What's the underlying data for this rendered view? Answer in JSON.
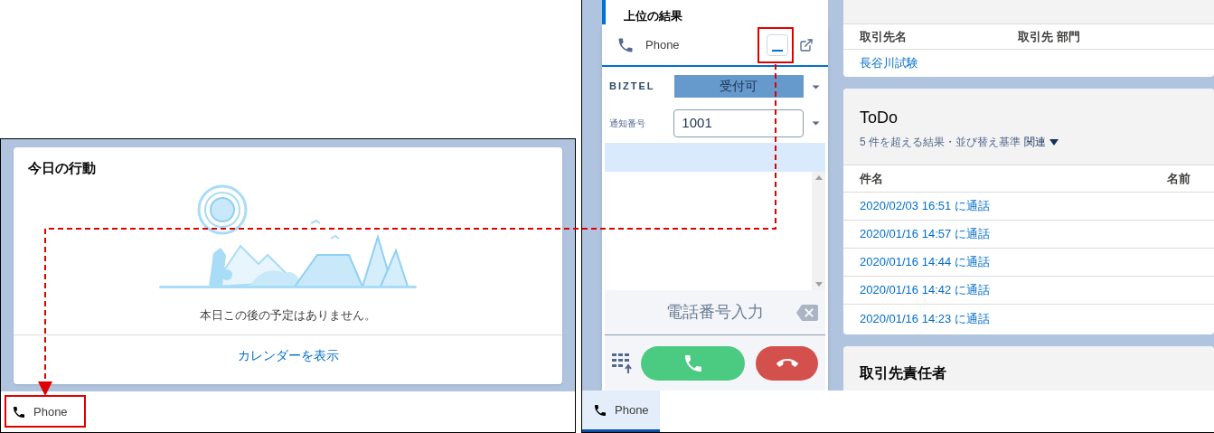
{
  "left_screen": {
    "card": {
      "title": "今日の行動",
      "message": "本日この後の予定はありません。",
      "link": "カレンダーを表示"
    },
    "utility_bar": {
      "items": [
        {
          "label": "Phone",
          "selected": false
        }
      ]
    }
  },
  "right_screen": {
    "results_panel": {
      "title": "上位の結果"
    },
    "phone_panel": {
      "title": "Phone",
      "brand": "BIZTEL",
      "status": "受付可",
      "caller_id_label": "通知番号",
      "caller_id": "1001",
      "dial_placeholder": "電話番号入力"
    },
    "accounts_card": {
      "columns": [
        "取引先名",
        "取引先 部門"
      ],
      "rows": [
        [
          "長谷川試験"
        ]
      ]
    },
    "todo_card": {
      "title": "ToDo",
      "subtitle": "5 件を超える結果・並び替え基準",
      "sort_link": "関連",
      "columns": [
        "件名",
        "名前"
      ],
      "rows": [
        "2020/02/03 16:51 に通話",
        "2020/01/16 14:57 に通話",
        "2020/01/16 14:44 に通話",
        "2020/01/16 14:42 に通話",
        "2020/01/16 14:23 に通話"
      ]
    },
    "contacts_card": {
      "title": "取引先責任者"
    },
    "utility_bar": {
      "items": [
        {
          "label": "Phone",
          "selected": true
        }
      ]
    }
  }
}
